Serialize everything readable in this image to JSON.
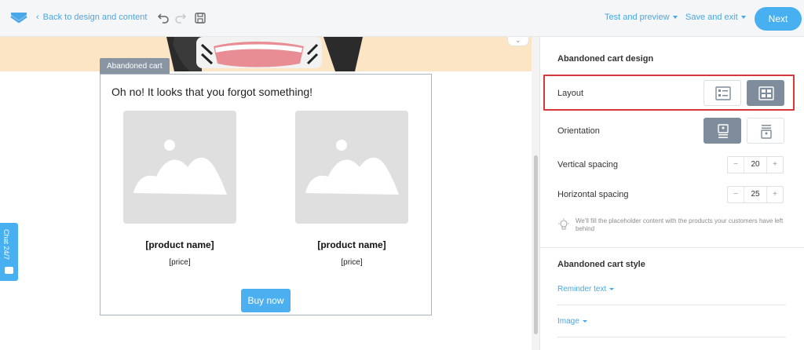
{
  "header": {
    "back_label": "Back to design and content",
    "test_preview_label": "Test and preview",
    "save_exit_label": "Save and exit",
    "next_label": "Next"
  },
  "canvas": {
    "block_tag": "Abandoned cart",
    "heading": "Oh no! It looks that you forgot something!",
    "products": [
      {
        "name": "[product name]",
        "price": "[price]"
      },
      {
        "name": "[product name]",
        "price": "[price]"
      }
    ],
    "buy_label": "Buy now",
    "chat_label": "Chat 24/7"
  },
  "panel": {
    "design_title": "Abandoned cart design",
    "layout_label": "Layout",
    "orientation_label": "Orientation",
    "vertical_spacing_label": "Vertical spacing",
    "vertical_spacing_value": "20",
    "horizontal_spacing_label": "Horizontal spacing",
    "horizontal_spacing_value": "25",
    "stepper_minus": "−",
    "stepper_plus": "+",
    "hint": "We'll fill the placeholder content with the products your customers have left behind",
    "style_title": "Abandoned cart style",
    "reminder_text_label": "Reminder text",
    "image_label": "Image"
  },
  "colors": {
    "accent": "#48b0f0",
    "highlight": "#d9383a",
    "active_option": "#7e8c9b"
  }
}
